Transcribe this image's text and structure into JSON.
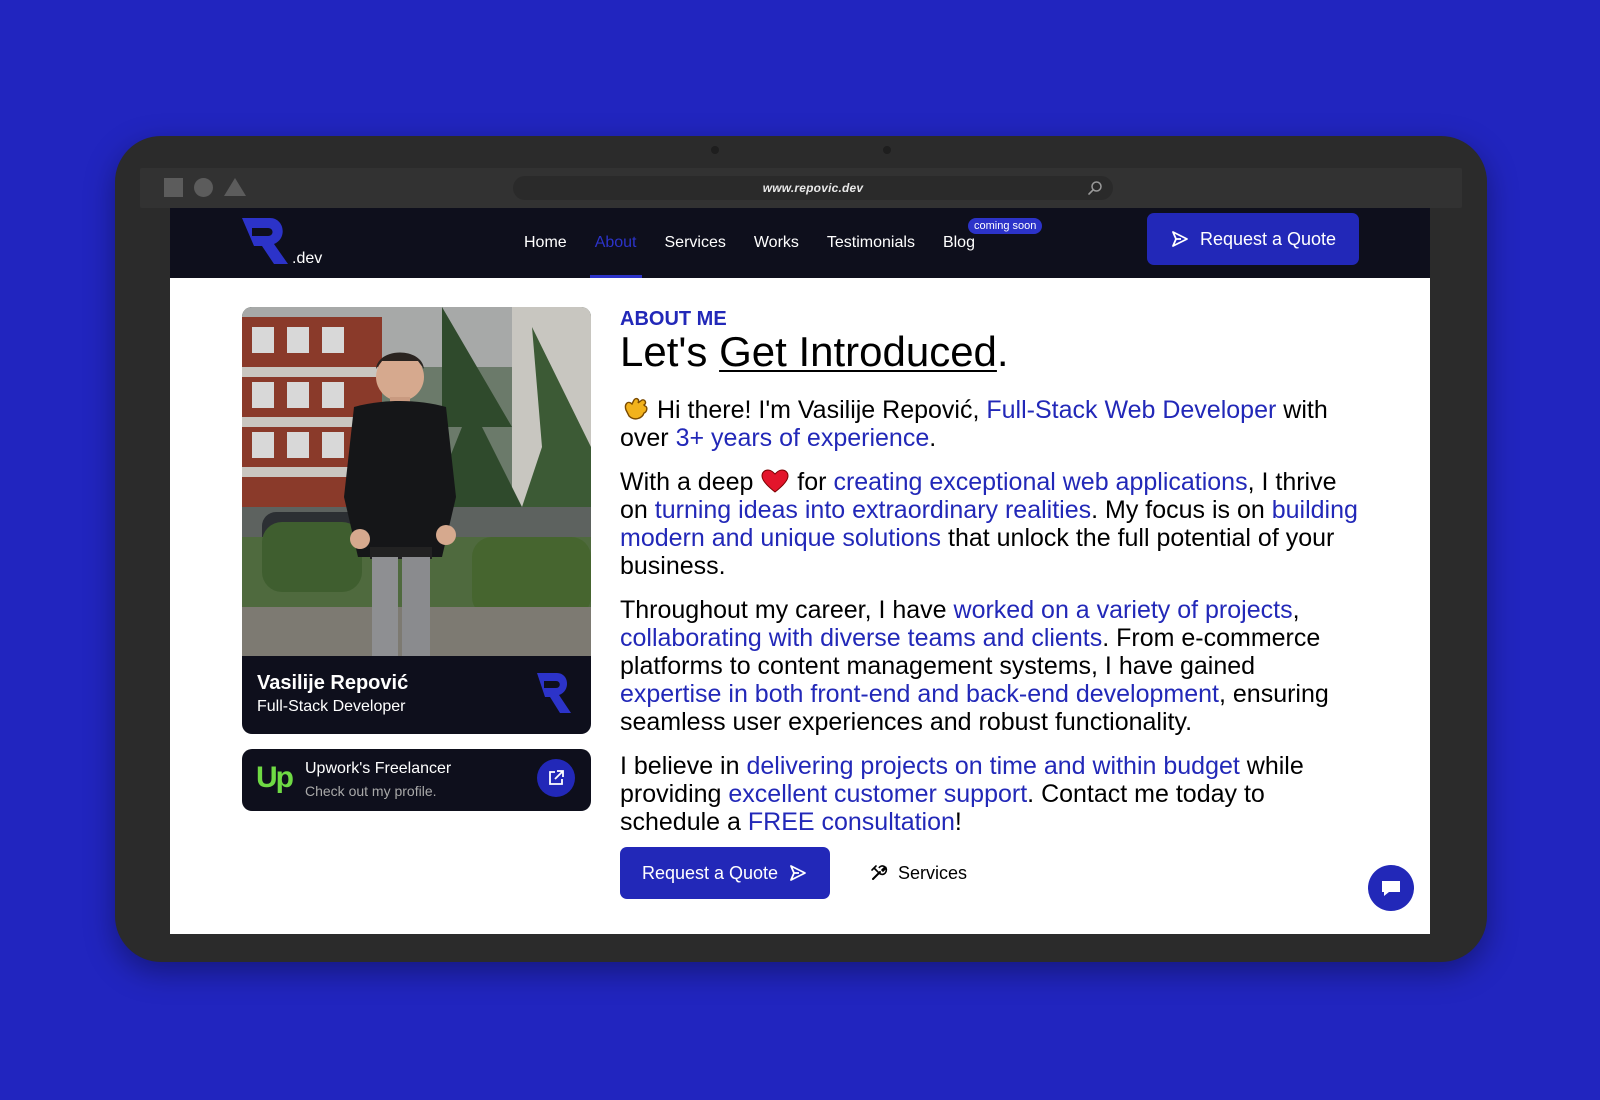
{
  "browser": {
    "url": "www.repovic.dev"
  },
  "nav": {
    "logo_letter": "R",
    "logo_suffix": ".dev",
    "items": [
      {
        "label": "Home",
        "active": false
      },
      {
        "label": "About",
        "active": true
      },
      {
        "label": "Services",
        "active": false
      },
      {
        "label": "Works",
        "active": false
      },
      {
        "label": "Testimonials",
        "active": false
      },
      {
        "label": "Blog",
        "active": false
      }
    ],
    "blog_badge": "coming soon",
    "cta_label": "Request a Quote"
  },
  "profile": {
    "name": "Vasilije Repović",
    "role": "Full-Stack Developer"
  },
  "upwork": {
    "logo_text": "Up",
    "title": "Upwork's Freelancer",
    "subtitle": "Check out my profile."
  },
  "about": {
    "eyebrow": "ABOUT ME",
    "heading_pre": "Let's ",
    "heading_underlined": "Get Introduced",
    "heading_post": ".",
    "p1": {
      "t1": " Hi there! I'm Vasilije Repović, ",
      "h1": "Full-Stack Web Developer",
      "t2": " with over ",
      "h2": "3+ years of experience",
      "t3": "."
    },
    "p2": {
      "t1": "With a deep ",
      "t2": " for ",
      "h1": "creating exceptional web applications",
      "t3": ", I thrive on ",
      "h2": "turning ideas into extraordinary realities",
      "t4": ". My focus is on ",
      "h3": "building modern and unique solutions",
      "t5": " that unlock the full potential of your business."
    },
    "p3": {
      "t1": "Throughout my career, I have ",
      "h1": "worked on a variety of projects",
      "t2": ", ",
      "h2": "collaborating with diverse teams and clients",
      "t3": ". From e-commerce platforms to content management systems, I have gained ",
      "h3": "expertise in both front-end and back-end development",
      "t4": ", ensuring seamless user experiences and robust functionality."
    },
    "p4": {
      "t1": "I believe in ",
      "h1": "delivering projects on time and within budget",
      "t2": " while providing ",
      "h2": "excellent customer support",
      "t3": ". Contact me today to schedule a ",
      "h3": "FREE consultation",
      "t4": "!"
    }
  },
  "actions": {
    "quote_label": "Request a Quote",
    "services_label": "Services"
  },
  "colors": {
    "background": "#2125bf",
    "accent": "#2228b8",
    "navbar": "#0e0f1c",
    "upwork_green": "#6fda44"
  },
  "icons": [
    "search-icon",
    "send-icon",
    "external-link-icon",
    "tools-icon",
    "chat-icon",
    "wave-emoji-icon",
    "heart-emoji-icon"
  ]
}
